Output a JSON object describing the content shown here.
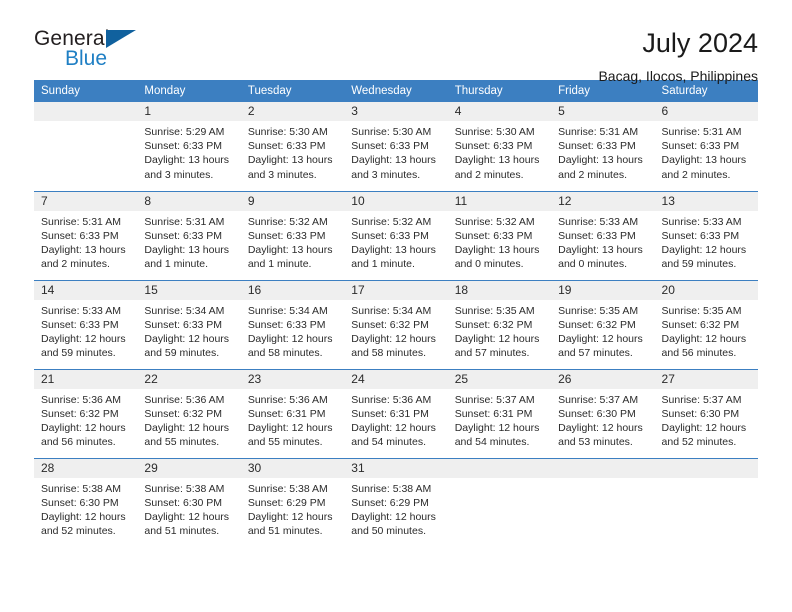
{
  "brand": {
    "name_primary": "General",
    "name_secondary": "Blue",
    "triangle_color": "#10619e",
    "accent_color": "#1f7fc4"
  },
  "header": {
    "title": "July 2024",
    "subtitle": "Bacag, Ilocos, Philippines"
  },
  "theme": {
    "header_row_bg": "#3c7fc1",
    "daynum_bg": "#efefef",
    "text_color": "#2b2b2b"
  },
  "calendar": {
    "weekday_headers": [
      "Sunday",
      "Monday",
      "Tuesday",
      "Wednesday",
      "Thursday",
      "Friday",
      "Saturday"
    ],
    "weeks": [
      [
        {
          "day": "",
          "empty": true,
          "sunrise": "",
          "sunset": "",
          "daylight_1": "",
          "daylight_2": ""
        },
        {
          "day": "1",
          "sunrise": "Sunrise: 5:29 AM",
          "sunset": "Sunset: 6:33 PM",
          "daylight_1": "Daylight: 13 hours",
          "daylight_2": "and 3 minutes."
        },
        {
          "day": "2",
          "sunrise": "Sunrise: 5:30 AM",
          "sunset": "Sunset: 6:33 PM",
          "daylight_1": "Daylight: 13 hours",
          "daylight_2": "and 3 minutes."
        },
        {
          "day": "3",
          "sunrise": "Sunrise: 5:30 AM",
          "sunset": "Sunset: 6:33 PM",
          "daylight_1": "Daylight: 13 hours",
          "daylight_2": "and 3 minutes."
        },
        {
          "day": "4",
          "sunrise": "Sunrise: 5:30 AM",
          "sunset": "Sunset: 6:33 PM",
          "daylight_1": "Daylight: 13 hours",
          "daylight_2": "and 2 minutes."
        },
        {
          "day": "5",
          "sunrise": "Sunrise: 5:31 AM",
          "sunset": "Sunset: 6:33 PM",
          "daylight_1": "Daylight: 13 hours",
          "daylight_2": "and 2 minutes."
        },
        {
          "day": "6",
          "sunrise": "Sunrise: 5:31 AM",
          "sunset": "Sunset: 6:33 PM",
          "daylight_1": "Daylight: 13 hours",
          "daylight_2": "and 2 minutes."
        }
      ],
      [
        {
          "day": "7",
          "sunrise": "Sunrise: 5:31 AM",
          "sunset": "Sunset: 6:33 PM",
          "daylight_1": "Daylight: 13 hours",
          "daylight_2": "and 2 minutes."
        },
        {
          "day": "8",
          "sunrise": "Sunrise: 5:31 AM",
          "sunset": "Sunset: 6:33 PM",
          "daylight_1": "Daylight: 13 hours",
          "daylight_2": "and 1 minute."
        },
        {
          "day": "9",
          "sunrise": "Sunrise: 5:32 AM",
          "sunset": "Sunset: 6:33 PM",
          "daylight_1": "Daylight: 13 hours",
          "daylight_2": "and 1 minute."
        },
        {
          "day": "10",
          "sunrise": "Sunrise: 5:32 AM",
          "sunset": "Sunset: 6:33 PM",
          "daylight_1": "Daylight: 13 hours",
          "daylight_2": "and 1 minute."
        },
        {
          "day": "11",
          "sunrise": "Sunrise: 5:32 AM",
          "sunset": "Sunset: 6:33 PM",
          "daylight_1": "Daylight: 13 hours",
          "daylight_2": "and 0 minutes."
        },
        {
          "day": "12",
          "sunrise": "Sunrise: 5:33 AM",
          "sunset": "Sunset: 6:33 PM",
          "daylight_1": "Daylight: 13 hours",
          "daylight_2": "and 0 minutes."
        },
        {
          "day": "13",
          "sunrise": "Sunrise: 5:33 AM",
          "sunset": "Sunset: 6:33 PM",
          "daylight_1": "Daylight: 12 hours",
          "daylight_2": "and 59 minutes."
        }
      ],
      [
        {
          "day": "14",
          "sunrise": "Sunrise: 5:33 AM",
          "sunset": "Sunset: 6:33 PM",
          "daylight_1": "Daylight: 12 hours",
          "daylight_2": "and 59 minutes."
        },
        {
          "day": "15",
          "sunrise": "Sunrise: 5:34 AM",
          "sunset": "Sunset: 6:33 PM",
          "daylight_1": "Daylight: 12 hours",
          "daylight_2": "and 59 minutes."
        },
        {
          "day": "16",
          "sunrise": "Sunrise: 5:34 AM",
          "sunset": "Sunset: 6:33 PM",
          "daylight_1": "Daylight: 12 hours",
          "daylight_2": "and 58 minutes."
        },
        {
          "day": "17",
          "sunrise": "Sunrise: 5:34 AM",
          "sunset": "Sunset: 6:32 PM",
          "daylight_1": "Daylight: 12 hours",
          "daylight_2": "and 58 minutes."
        },
        {
          "day": "18",
          "sunrise": "Sunrise: 5:35 AM",
          "sunset": "Sunset: 6:32 PM",
          "daylight_1": "Daylight: 12 hours",
          "daylight_2": "and 57 minutes."
        },
        {
          "day": "19",
          "sunrise": "Sunrise: 5:35 AM",
          "sunset": "Sunset: 6:32 PM",
          "daylight_1": "Daylight: 12 hours",
          "daylight_2": "and 57 minutes."
        },
        {
          "day": "20",
          "sunrise": "Sunrise: 5:35 AM",
          "sunset": "Sunset: 6:32 PM",
          "daylight_1": "Daylight: 12 hours",
          "daylight_2": "and 56 minutes."
        }
      ],
      [
        {
          "day": "21",
          "sunrise": "Sunrise: 5:36 AM",
          "sunset": "Sunset: 6:32 PM",
          "daylight_1": "Daylight: 12 hours",
          "daylight_2": "and 56 minutes."
        },
        {
          "day": "22",
          "sunrise": "Sunrise: 5:36 AM",
          "sunset": "Sunset: 6:32 PM",
          "daylight_1": "Daylight: 12 hours",
          "daylight_2": "and 55 minutes."
        },
        {
          "day": "23",
          "sunrise": "Sunrise: 5:36 AM",
          "sunset": "Sunset: 6:31 PM",
          "daylight_1": "Daylight: 12 hours",
          "daylight_2": "and 55 minutes."
        },
        {
          "day": "24",
          "sunrise": "Sunrise: 5:36 AM",
          "sunset": "Sunset: 6:31 PM",
          "daylight_1": "Daylight: 12 hours",
          "daylight_2": "and 54 minutes."
        },
        {
          "day": "25",
          "sunrise": "Sunrise: 5:37 AM",
          "sunset": "Sunset: 6:31 PM",
          "daylight_1": "Daylight: 12 hours",
          "daylight_2": "and 54 minutes."
        },
        {
          "day": "26",
          "sunrise": "Sunrise: 5:37 AM",
          "sunset": "Sunset: 6:30 PM",
          "daylight_1": "Daylight: 12 hours",
          "daylight_2": "and 53 minutes."
        },
        {
          "day": "27",
          "sunrise": "Sunrise: 5:37 AM",
          "sunset": "Sunset: 6:30 PM",
          "daylight_1": "Daylight: 12 hours",
          "daylight_2": "and 52 minutes."
        }
      ],
      [
        {
          "day": "28",
          "sunrise": "Sunrise: 5:38 AM",
          "sunset": "Sunset: 6:30 PM",
          "daylight_1": "Daylight: 12 hours",
          "daylight_2": "and 52 minutes."
        },
        {
          "day": "29",
          "sunrise": "Sunrise: 5:38 AM",
          "sunset": "Sunset: 6:30 PM",
          "daylight_1": "Daylight: 12 hours",
          "daylight_2": "and 51 minutes."
        },
        {
          "day": "30",
          "sunrise": "Sunrise: 5:38 AM",
          "sunset": "Sunset: 6:29 PM",
          "daylight_1": "Daylight: 12 hours",
          "daylight_2": "and 51 minutes."
        },
        {
          "day": "31",
          "sunrise": "Sunrise: 5:38 AM",
          "sunset": "Sunset: 6:29 PM",
          "daylight_1": "Daylight: 12 hours",
          "daylight_2": "and 50 minutes."
        },
        {
          "day": "",
          "empty": true,
          "sunrise": "",
          "sunset": "",
          "daylight_1": "",
          "daylight_2": ""
        },
        {
          "day": "",
          "empty": true,
          "sunrise": "",
          "sunset": "",
          "daylight_1": "",
          "daylight_2": ""
        },
        {
          "day": "",
          "empty": true,
          "sunrise": "",
          "sunset": "",
          "daylight_1": "",
          "daylight_2": ""
        }
      ]
    ]
  }
}
